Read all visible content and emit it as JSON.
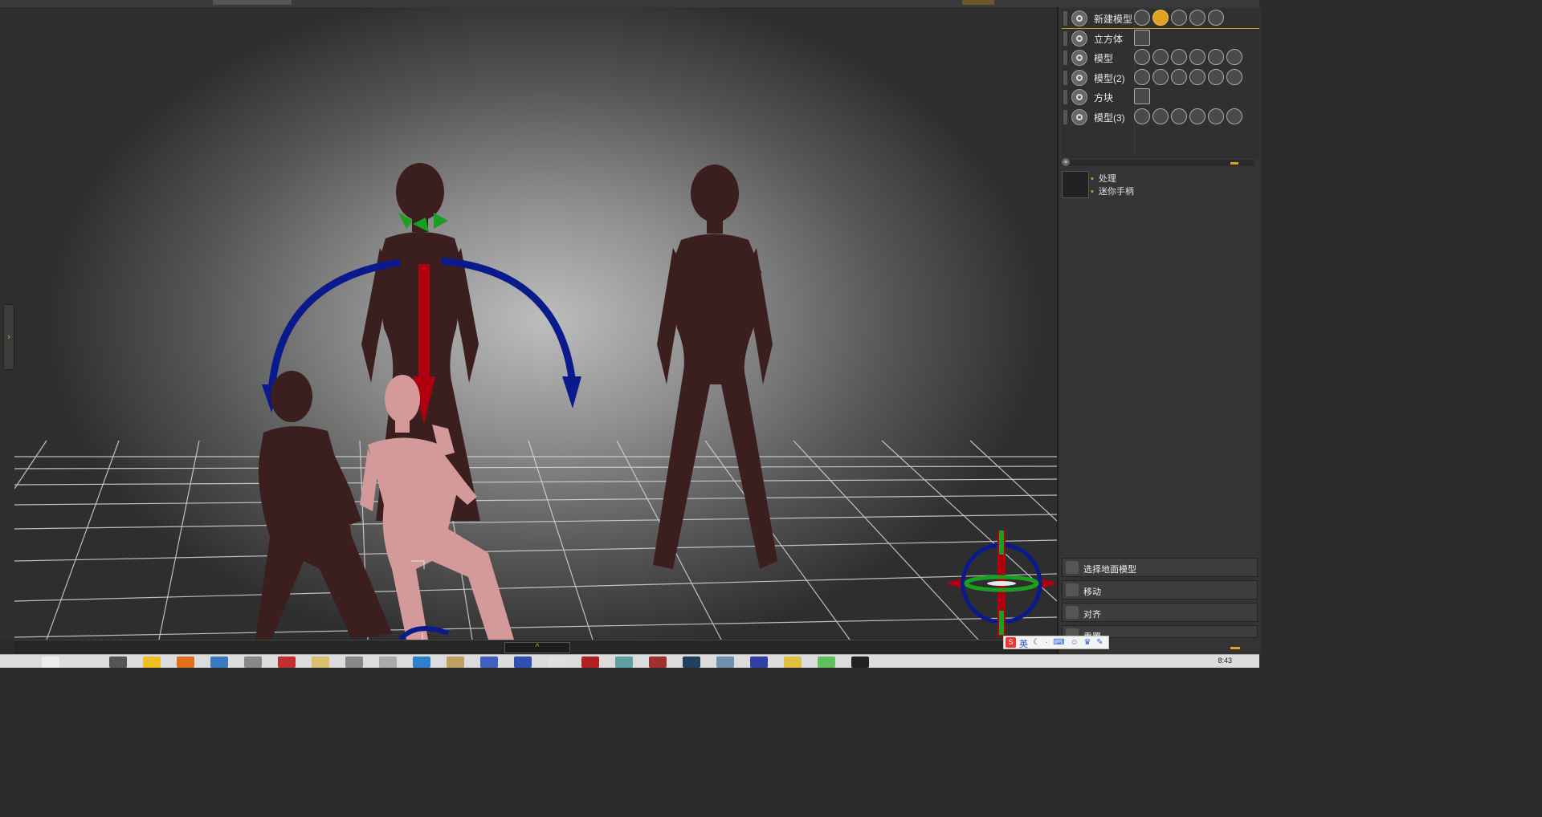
{
  "models": [
    {
      "name": "新建模型",
      "selected": true,
      "tools": [
        "move-tool-icon",
        "rotate-tool-icon",
        "zoom-tool-icon",
        "scale-tool-icon",
        "hand-tool-icon"
      ]
    },
    {
      "name": "立方体",
      "selected": false,
      "tools": [
        "cube-icon"
      ]
    },
    {
      "name": "模型",
      "selected": false,
      "tools": [
        "move-tool-icon",
        "rotate-tool-icon",
        "zoom-tool-icon",
        "scale-tool-icon",
        "hand-tool-icon",
        "foot-tool-icon"
      ]
    },
    {
      "name": "模型(2)",
      "selected": false,
      "tools": [
        "move-tool-icon",
        "rotate-tool-icon",
        "zoom-tool-icon",
        "scale-tool-icon",
        "hand-tool-icon",
        "foot-tool-icon"
      ]
    },
    {
      "name": "方块",
      "selected": false,
      "tools": [
        "cube-icon"
      ]
    },
    {
      "name": "模型(3)",
      "selected": false,
      "tools": [
        "move-tool-icon",
        "rotate-tool-icon",
        "zoom-tool-icon",
        "scale-tool-icon",
        "hand-tool-icon",
        "foot-tool-icon"
      ]
    }
  ],
  "properties": {
    "item1": "处理",
    "item2": "迷你手柄"
  },
  "actions": {
    "select_ground": "选择地面模型",
    "move": "移动",
    "align": "对齐",
    "reset": "重置"
  },
  "ime": {
    "lang": "英"
  },
  "viewport": {
    "collapse_glyph": "^",
    "left_toggle_glyph": "›"
  },
  "colors": {
    "accent": "#e0a020",
    "panel": "#343434",
    "gizmo_blue": "#0a1a8c",
    "gizmo_red": "#b00010",
    "gizmo_green": "#1aa020",
    "figure_dark": "#3b1e1e",
    "figure_pink": "#d49a9a"
  },
  "clock": "8:43"
}
